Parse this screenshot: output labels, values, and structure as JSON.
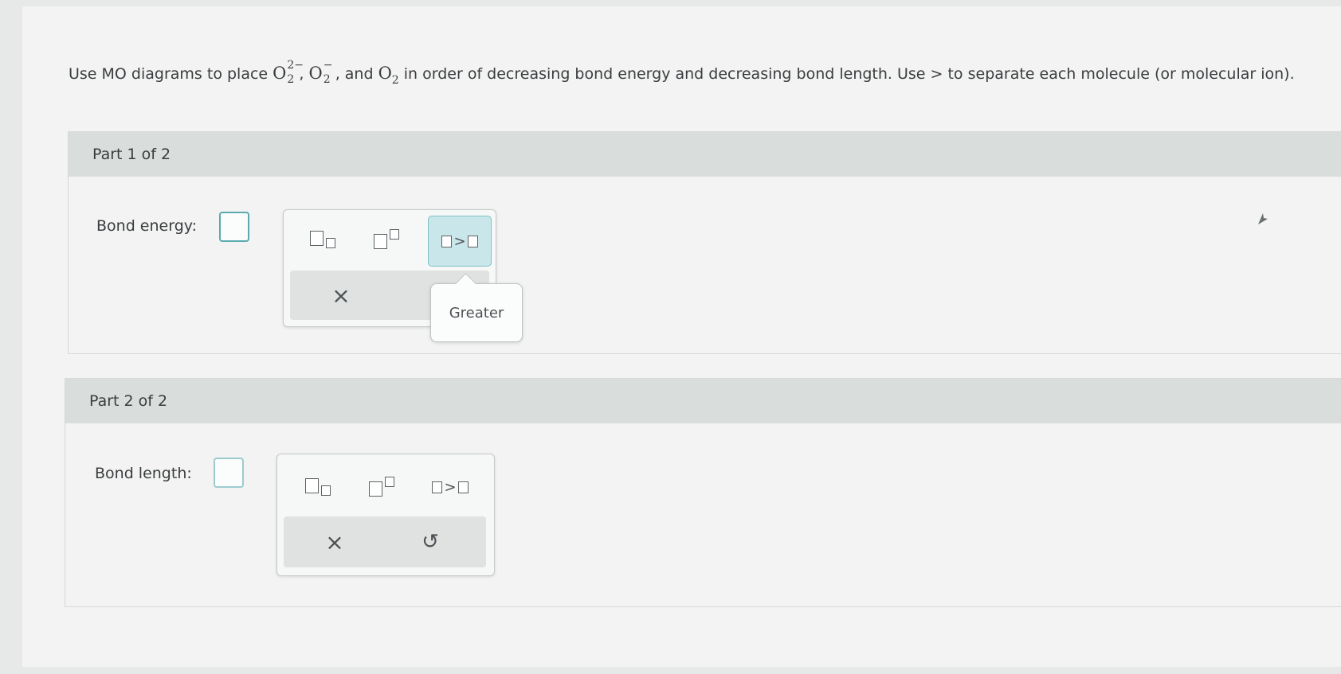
{
  "question": {
    "prefix": "Use MO diagrams to place",
    "species1_base": "O",
    "species1_sub": "2",
    "species1_sup": "2−",
    "species2_base": "O",
    "species2_sub": "2",
    "species2_sup": "−",
    "and_word": "and",
    "species3_base": "O",
    "species3_sub": "2",
    "suffix": "in order of decreasing bond energy and decreasing bond length. Use > to separate each molecule (or molecular ion)."
  },
  "part1": {
    "title": "Part 1 of 2",
    "field_label": "Bond energy:",
    "tools": {
      "greater_symbol": ">"
    },
    "actions": {
      "clear_symbol": "×"
    },
    "tooltip": "Greater"
  },
  "part2": {
    "title": "Part 2 of 2",
    "field_label": "Bond length:",
    "tools": {
      "greater_symbol": ">"
    },
    "actions": {
      "clear_symbol": "×",
      "undo_symbol": "↺"
    }
  },
  "colors": {
    "accent": "#5aaab0",
    "active_tool": "#c9e7ea",
    "header": "#d9dedc"
  }
}
